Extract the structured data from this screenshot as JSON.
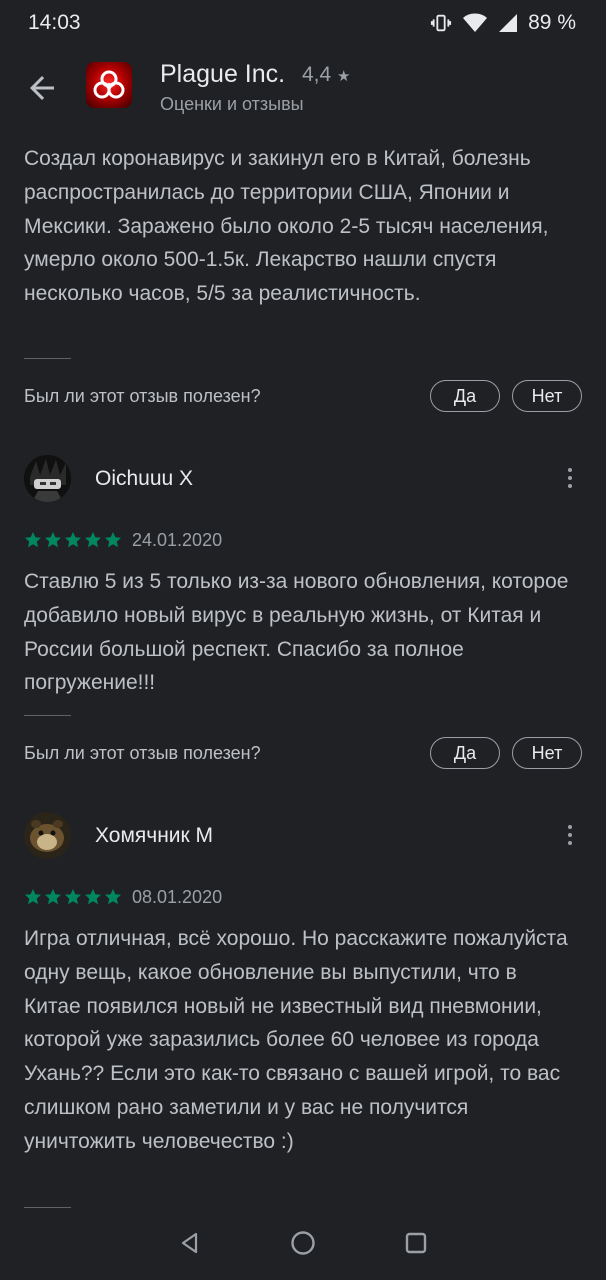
{
  "status": {
    "time": "14:03",
    "battery": "89 %"
  },
  "app": {
    "title": "Plague Inc.",
    "rating": "4,4",
    "subtitle": "Оценки и отзывы"
  },
  "colors": {
    "background": "#202124",
    "star_green": "#01875f",
    "text": "#e8eaed",
    "muted": "#9aa0a6"
  },
  "helpful_question": "Был ли этот отзыв полезен?",
  "yes_label": "Да",
  "no_label": "Нет",
  "reviews": [
    {
      "text": "Создал коронавирус и закинул его в Китай, болезнь распространилась до территории США, Японии и Мексики. Заражено было около 2-5 тысяч населения, умерло около 500-1.5к. Лекарство нашли спустя несколько часов, 5/5 за реалистичность."
    },
    {
      "author": "Oichuuu X",
      "stars": 5,
      "date": "24.01.2020",
      "text": "Ставлю 5 из 5 только из-за нового обновления, которое добавило новый вирус в реальную жизнь, от Китая и России большой респект. Спасибо за полное погружение!!!"
    },
    {
      "author": "Хомячник М",
      "stars": 5,
      "date": "08.01.2020",
      "text": "Игра отличная, всё хорошо. Но расскажите пожалуйста одну вещь, какое обновление вы выпустили, что в Китае появился новый не известный вид пневмонии, которой уже заразились более 60 человее из города Ухань?? Если это как-то связано с вашей игрой, то вас слишком рано заметили и у вас не получится уничтожить человечество :)"
    }
  ]
}
